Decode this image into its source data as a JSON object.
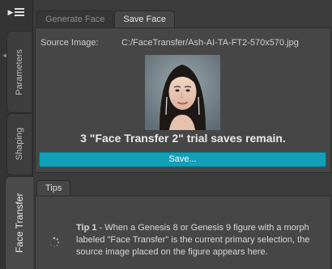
{
  "side_tabs": {
    "parameters": "Parameters",
    "shaping": "Shaping",
    "face_transfer": "Face Transfer"
  },
  "top_tabs": {
    "generate_face": "Generate Face",
    "save_face": "Save Face"
  },
  "source": {
    "label": "Source Image:",
    "path": "C:/FaceTransfer/Ash-AI-TA-FT2-570x570.jpg"
  },
  "trial_message": "3 \"Face Transfer 2\" trial saves remain.",
  "save_button": "Save...",
  "tips": {
    "tab_label": "Tips",
    "tip_title": "Tip 1",
    "tip_body": " - When a Genesis 8 or Genesis 9 figure with a morph labeled \"Face Transfer\" is the current primary selection, the source image placed on the figure appears here."
  },
  "colors": {
    "accent_button": "#12a0b8",
    "panel_bg": "#464646",
    "window_bg": "#3b3b3b"
  },
  "icons": [
    "menu-icon",
    "collapse-arrow-icon",
    "loading-spinner-icon"
  ]
}
